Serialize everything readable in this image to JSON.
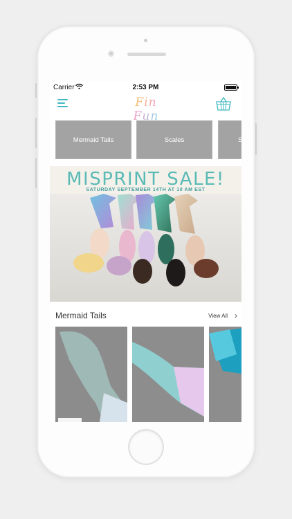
{
  "status_bar": {
    "carrier": "Carrier",
    "time": "2:53 PM"
  },
  "nav": {
    "menu_icon": "hamburger-icon",
    "logo_text": "Fin Fun",
    "cart_icon": "basket-icon"
  },
  "categories": [
    {
      "label": "Mermaid Tails"
    },
    {
      "label": "Scales"
    },
    {
      "label": "S"
    }
  ],
  "banner": {
    "title": "MISPRINT SALE!",
    "subtitle": "SATURDAY SEPTEMBER 14TH AT 10 AM EST"
  },
  "section": {
    "title": "Mermaid Tails",
    "view_all": "View All"
  },
  "colors": {
    "accent": "#3fb8bf",
    "category_tile": "#a3a3a3",
    "banner_text": "#5bbab5"
  }
}
